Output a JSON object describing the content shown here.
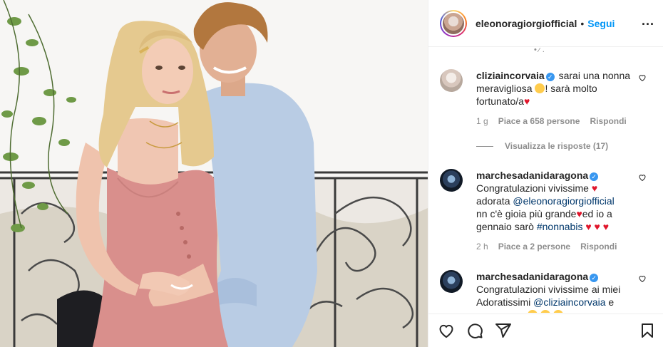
{
  "header": {
    "username": "eleonoragiorgiofficial",
    "separator": "•",
    "follow_label": "Segui",
    "more_label": "..."
  },
  "comments": {
    "cut_text": "•  ⁄ ,",
    "items": [
      {
        "username": "cliziaincorvaia",
        "verified": true,
        "text_parts": [
          "sarai una nonna",
          "meravigliosa",
          "! sarà molto",
          "fortunato/a"
        ],
        "meta": {
          "time": "1 g",
          "likes": "Piace a 658 persone",
          "reply": "Rispondi"
        },
        "replies_label": "Visualizza le risposte (17)"
      },
      {
        "username": "marchesadanidaragona",
        "verified": true,
        "text_parts": [
          "Congratulazioni vivissime",
          "adorata",
          "@eleonoragiorgiofficial",
          "nn c'è gioia più grande",
          "ed io a",
          "gennaio sarò",
          "#nonnabis"
        ],
        "meta": {
          "time": "2 h",
          "likes": "Piace a 2 persone",
          "reply": "Rispondi"
        }
      },
      {
        "username": "marchesadanidaragona",
        "verified": true,
        "text_parts": [
          "Congratulazioni vivissime ai miei",
          "Adoratissimi",
          "@cliziaincorvaia",
          "e"
        ]
      }
    ]
  },
  "icons": {
    "verified": "verified-badge-icon",
    "like_small": "heart-outline-icon",
    "like": "heart-outline-icon",
    "comment": "comment-icon",
    "share": "send-icon",
    "save": "bookmark-icon"
  },
  "colors": {
    "accent": "#0095f6",
    "mention": "#00376b",
    "muted": "#8e8e8e",
    "verified": "#3897f0",
    "heart": "#e0162b"
  }
}
